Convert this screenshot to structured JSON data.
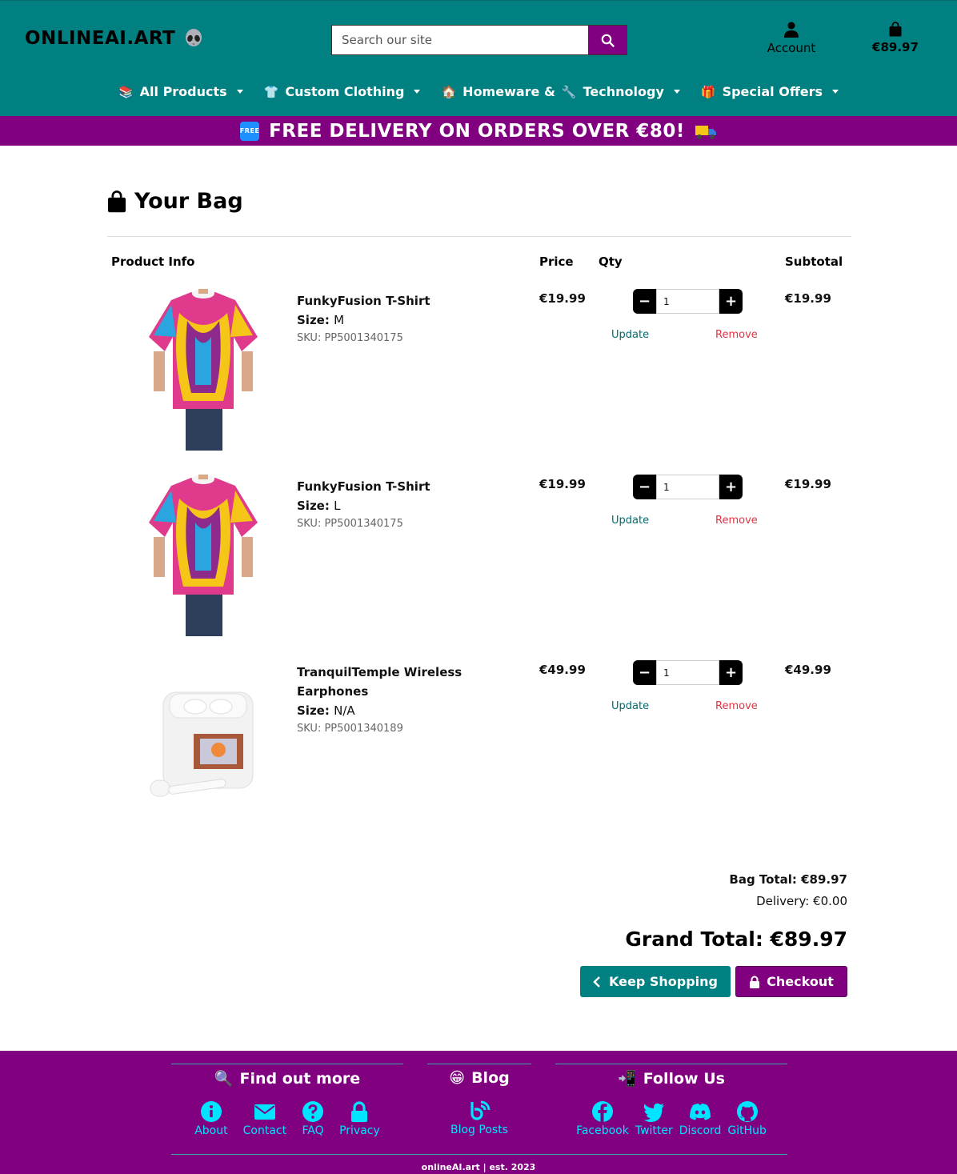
{
  "header": {
    "logo": "ONLINEAI.ART",
    "search_placeholder": "Search our site",
    "account_label": "Account",
    "bag_total": "€89.97"
  },
  "nav": [
    {
      "emoji": "📚",
      "label": "All Products"
    },
    {
      "emoji": "👕",
      "label": "Custom Clothing"
    },
    {
      "emoji": "🏠",
      "label": "Homeware &"
    },
    {
      "emoji": "🔧",
      "label": "Technology"
    },
    {
      "emoji": "🎁",
      "label": "Special Offers"
    }
  ],
  "banner": {
    "badge": "FREE",
    "text": "FREE DELIVERY ON ORDERS OVER €80!"
  },
  "bag": {
    "title": "Your Bag",
    "headers": {
      "product": "Product Info",
      "price": "Price",
      "qty": "Qty",
      "subtotal": "Subtotal"
    },
    "size_label": "Size:",
    "update_label": "Update",
    "remove_label": "Remove",
    "items": [
      {
        "name": "FunkyFusion T-Shirt",
        "size": "M",
        "sku": "SKU: PP5001340175",
        "price": "€19.99",
        "qty": "1",
        "subtotal": "€19.99",
        "image": "t-shirt"
      },
      {
        "name": "FunkyFusion T-Shirt",
        "size": "L",
        "sku": "SKU: PP5001340175",
        "price": "€19.99",
        "qty": "1",
        "subtotal": "€19.99",
        "image": "t-shirt"
      },
      {
        "name": "TranquilTemple Wireless Earphones",
        "size": "N/A",
        "sku": "SKU: PP5001340189",
        "price": "€49.99",
        "qty": "1",
        "subtotal": "€49.99",
        "image": "earphones"
      }
    ],
    "bag_total": "Bag Total: €89.97",
    "delivery": "Delivery: €0.00",
    "grand_total": "Grand Total: €89.97",
    "keep_shopping": "Keep Shopping",
    "checkout": "Checkout"
  },
  "footer": {
    "find_out_more": {
      "emoji": "🔍",
      "title": "Find out more",
      "links": [
        "About",
        "Contact",
        "FAQ",
        "Privacy"
      ]
    },
    "blog": {
      "emoji": "😁",
      "title": "Blog",
      "links": [
        "Blog Posts"
      ]
    },
    "follow": {
      "emoji": "📲",
      "title": "Follow Us",
      "links": [
        "Facebook",
        "Twitter",
        "Discord",
        "GitHub"
      ]
    },
    "copyright": "onlineAI.art | est. 2023"
  },
  "colors": {
    "teal": "#008080",
    "purple": "#800080",
    "cyan": "#00e5ff",
    "remove_red": "#dc3545"
  }
}
